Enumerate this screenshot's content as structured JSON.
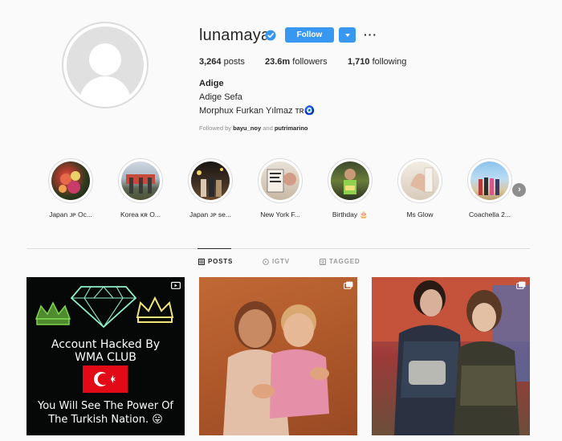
{
  "profile": {
    "username": "lunamaya",
    "follow_label": "Follow",
    "more_label": "···",
    "stats": {
      "posts_value": "3,264",
      "posts_label": "posts",
      "followers_value": "23.6m",
      "followers_label": "followers",
      "following_value": "1,710",
      "following_label": "following"
    },
    "bio": {
      "name": "Adige",
      "line1": "Adige Sefa",
      "line2": "Morphux Furkan Yılmaz ᴛʀ🧿",
      "followed_prefix": "Followed by",
      "followed_user1": "bayu_noy",
      "followed_and": "and",
      "followed_user2": "putrimarino"
    }
  },
  "highlights": [
    {
      "label": "Japan ᴊᴘ Oc..."
    },
    {
      "label": "Korea ᴋʀ O..."
    },
    {
      "label": "Japan ᴊᴘ se..."
    },
    {
      "label": "New York F..."
    },
    {
      "label": "Birthday 🎂"
    },
    {
      "label": "Ms Glow"
    },
    {
      "label": "Coachella 2..."
    }
  ],
  "tabs": [
    {
      "label": "POSTS",
      "active": true
    },
    {
      "label": "IGTV",
      "active": false
    },
    {
      "label": "TAGGED",
      "active": false
    }
  ],
  "posts": [
    {
      "text1": "Account Hacked By",
      "text2": "WMA CLUB",
      "text3": "You Will See The Power Of",
      "text4": "The Turkish Nation. 😛",
      "type_icon": "igtv-icon"
    },
    {
      "type_icon": "carousel-icon"
    },
    {
      "type_icon": "carousel-icon"
    }
  ],
  "colors": {
    "accent": "#3897f0",
    "verified": "#3897f0",
    "neon_green": "#7fd651",
    "neon_cyan": "#8ef0c8",
    "neon_yellow": "#f2e27a",
    "turkey_red": "#e30a17"
  }
}
